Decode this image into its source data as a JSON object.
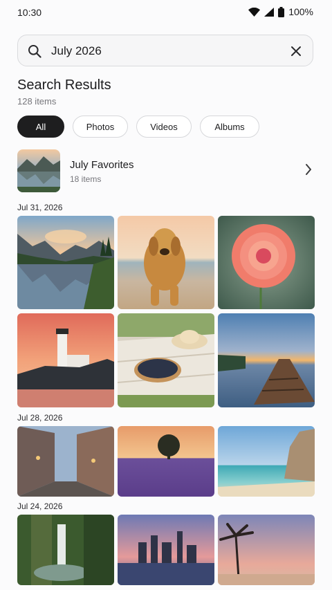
{
  "status": {
    "time": "10:30",
    "battery": "100%"
  },
  "search": {
    "query": "July 2026"
  },
  "header": {
    "title": "Search Results",
    "count": "128 items"
  },
  "filters": [
    "All",
    "Photos",
    "Videos",
    "Albums"
  ],
  "album": {
    "name": "July Favorites",
    "count": "18 items"
  },
  "groups": [
    {
      "date": "Jul 31, 2026",
      "photos": [
        "lake-mountains",
        "golden-retriever-beach",
        "pink-dahlia",
        "lighthouse-sunset",
        "blueberry-picnic",
        "wooden-pier-sunset"
      ]
    },
    {
      "date": "Jul 28, 2026",
      "photos": [
        "old-town-street",
        "lavender-field-tree",
        "beach-cliffs"
      ]
    },
    {
      "date": "Jul 24, 2026",
      "photos": [
        "forest-waterfall",
        "city-skyline-dusk",
        "palm-tree-beach"
      ]
    }
  ]
}
